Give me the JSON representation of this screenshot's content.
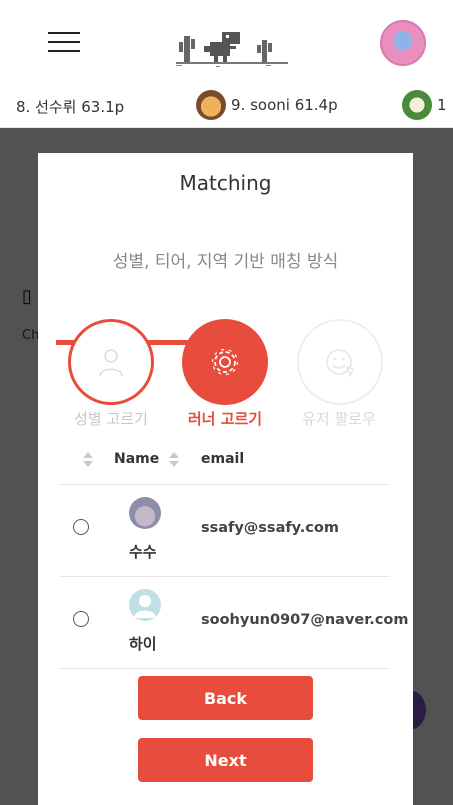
{
  "header": {
    "menu_icon": "hamburger-icon",
    "logo_icon": "dino-cactus-logo",
    "avatar": "user-avatar"
  },
  "ranking": [
    {
      "text": "8. 선수뤼 63.1p"
    },
    {
      "text": "9. sooni 61.4p"
    },
    {
      "text": "1"
    }
  ],
  "background_page": {
    "title_glyph": "▯",
    "subtitle": "Ch"
  },
  "modal": {
    "title": "Matching",
    "description": "성별, 티어, 지역 기반 매칭 방식",
    "steps": [
      {
        "label": "성별 고르기",
        "icon": "person-icon",
        "state": "done"
      },
      {
        "label": "러너 고르기",
        "icon": "gear-icon",
        "state": "active"
      },
      {
        "label": "유저 팔로우",
        "icon": "smile-icon",
        "state": "pending"
      }
    ],
    "table": {
      "columns": [
        "Name",
        "email"
      ],
      "rows": [
        {
          "name": "수수",
          "email": "ssafy@ssafy.com",
          "selected": false
        },
        {
          "name": "하이",
          "email": "soohyun0907@naver.com",
          "selected": false
        }
      ]
    },
    "back_label": "Back",
    "next_label": "Next"
  },
  "colors": {
    "accent": "#e74c3c",
    "overlay": "rgba(0,0,0,0.68)"
  }
}
